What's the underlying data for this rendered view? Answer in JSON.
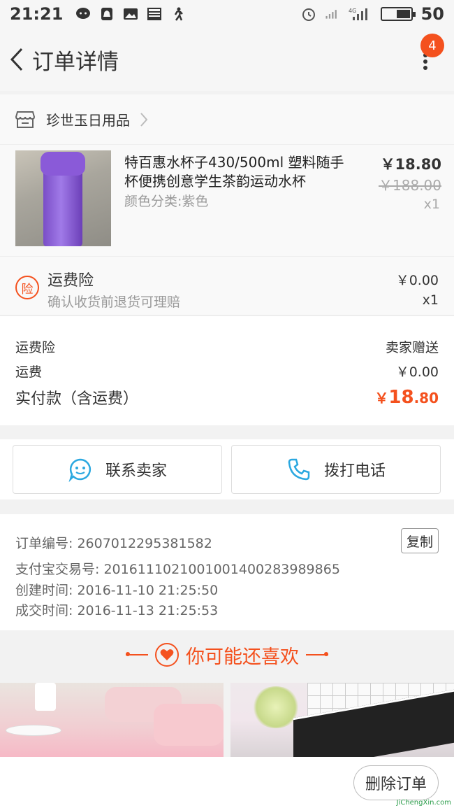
{
  "status_bar": {
    "time": "21:21",
    "battery": "50",
    "battery_level": 0.5,
    "network": "4G"
  },
  "nav": {
    "title": "订单详情",
    "badge_count": "4"
  },
  "shop": {
    "name": "珍世玉日用品"
  },
  "product": {
    "title": "特百惠水杯子430/500ml 塑料随手杯便携创意学生茶韵运动水杯",
    "spec": "颜色分类:紫色",
    "price": "￥18.80",
    "original_price": "￥188.00",
    "quantity": "x1"
  },
  "insurance": {
    "icon_char": "险",
    "title": "运费险",
    "subtitle": "确认收货前退货可理赔",
    "price": "￥0.00",
    "quantity": "x1"
  },
  "summary": {
    "rows": [
      {
        "label": "运费险",
        "value": "卖家赠送"
      },
      {
        "label": "运费",
        "value": "￥0.00"
      }
    ],
    "total_label": "实付款（含运费）",
    "total_currency": "￥",
    "total_int": "18",
    "total_dec": ".80"
  },
  "actions": {
    "contact_seller": "联系卖家",
    "call_phone": "拨打电话"
  },
  "order_info": {
    "order_no": "订单编号: 2607012295381582",
    "alipay_no": "支付宝交易号: 2016111021001001400283989865",
    "created": "创建时间: 2016-11-10 21:25:50",
    "completed": "成交时间: 2016-11-13 21:25:53",
    "copy_label": "复制"
  },
  "recommend": {
    "title": "你可能还喜欢"
  },
  "bottom": {
    "delete_label": "删除订单",
    "watermark": "JiChengXin.com"
  },
  "colors": {
    "accent": "#f4511e",
    "icon_blue": "#2ba8e0"
  }
}
